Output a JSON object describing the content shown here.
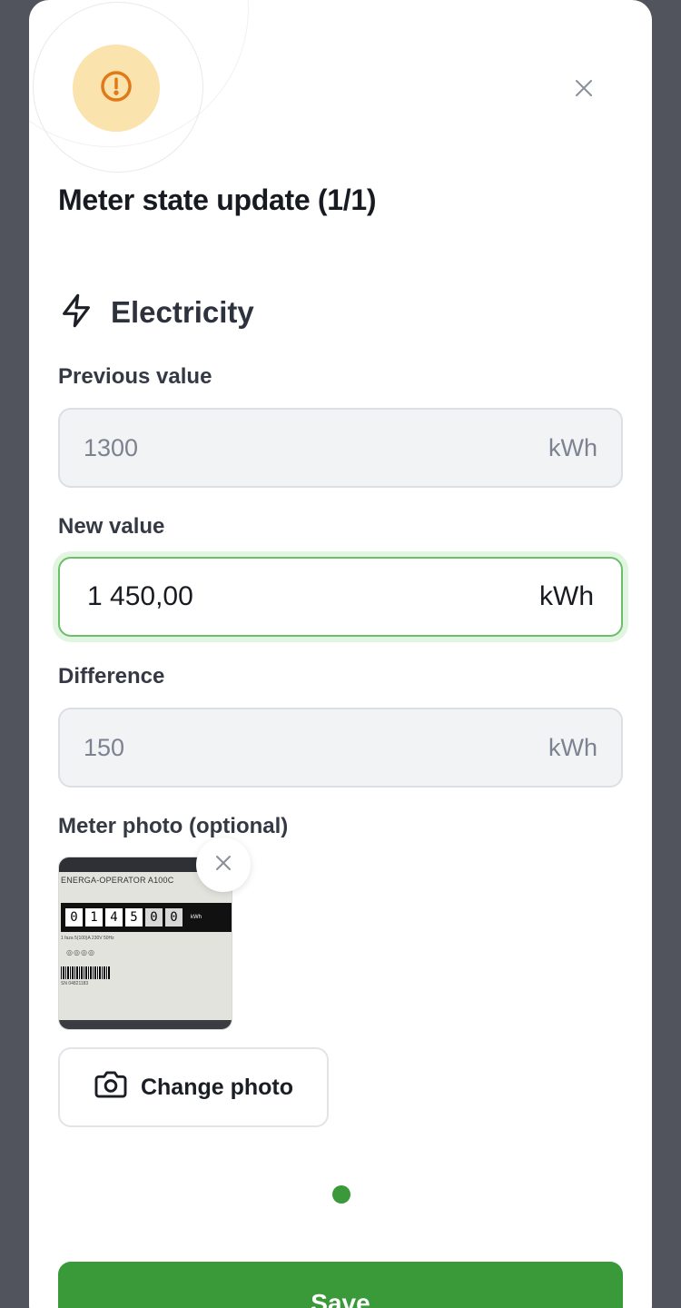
{
  "dialog": {
    "title": "Meter state update (1/1)",
    "icon": "warning-circle-icon",
    "accent_color": "#3a9a3a",
    "warning_color": "#e0791a"
  },
  "section": {
    "icon": "lightning-bolt-icon",
    "label": "Electricity"
  },
  "fields": {
    "previous": {
      "label": "Previous value",
      "value": "1300",
      "unit": "kWh"
    },
    "new": {
      "label": "New value",
      "value": "1 450,00",
      "unit": "kWh"
    },
    "difference": {
      "label": "Difference",
      "value": "150",
      "unit": "kWh"
    }
  },
  "photo": {
    "label": "Meter photo (optional)",
    "change_label": "Change photo",
    "meter": {
      "brand": "ENERGA-OPERATOR  A100C",
      "digits": [
        "0",
        "1",
        "4",
        "5",
        "0",
        "0"
      ],
      "unit": "kWh",
      "spec": "1 faza    5(100)A    230V    50Hz",
      "serial": "SN 04821183"
    }
  },
  "pagination": {
    "current": 1,
    "total": 1
  },
  "footer": {
    "save_label": "Save"
  }
}
